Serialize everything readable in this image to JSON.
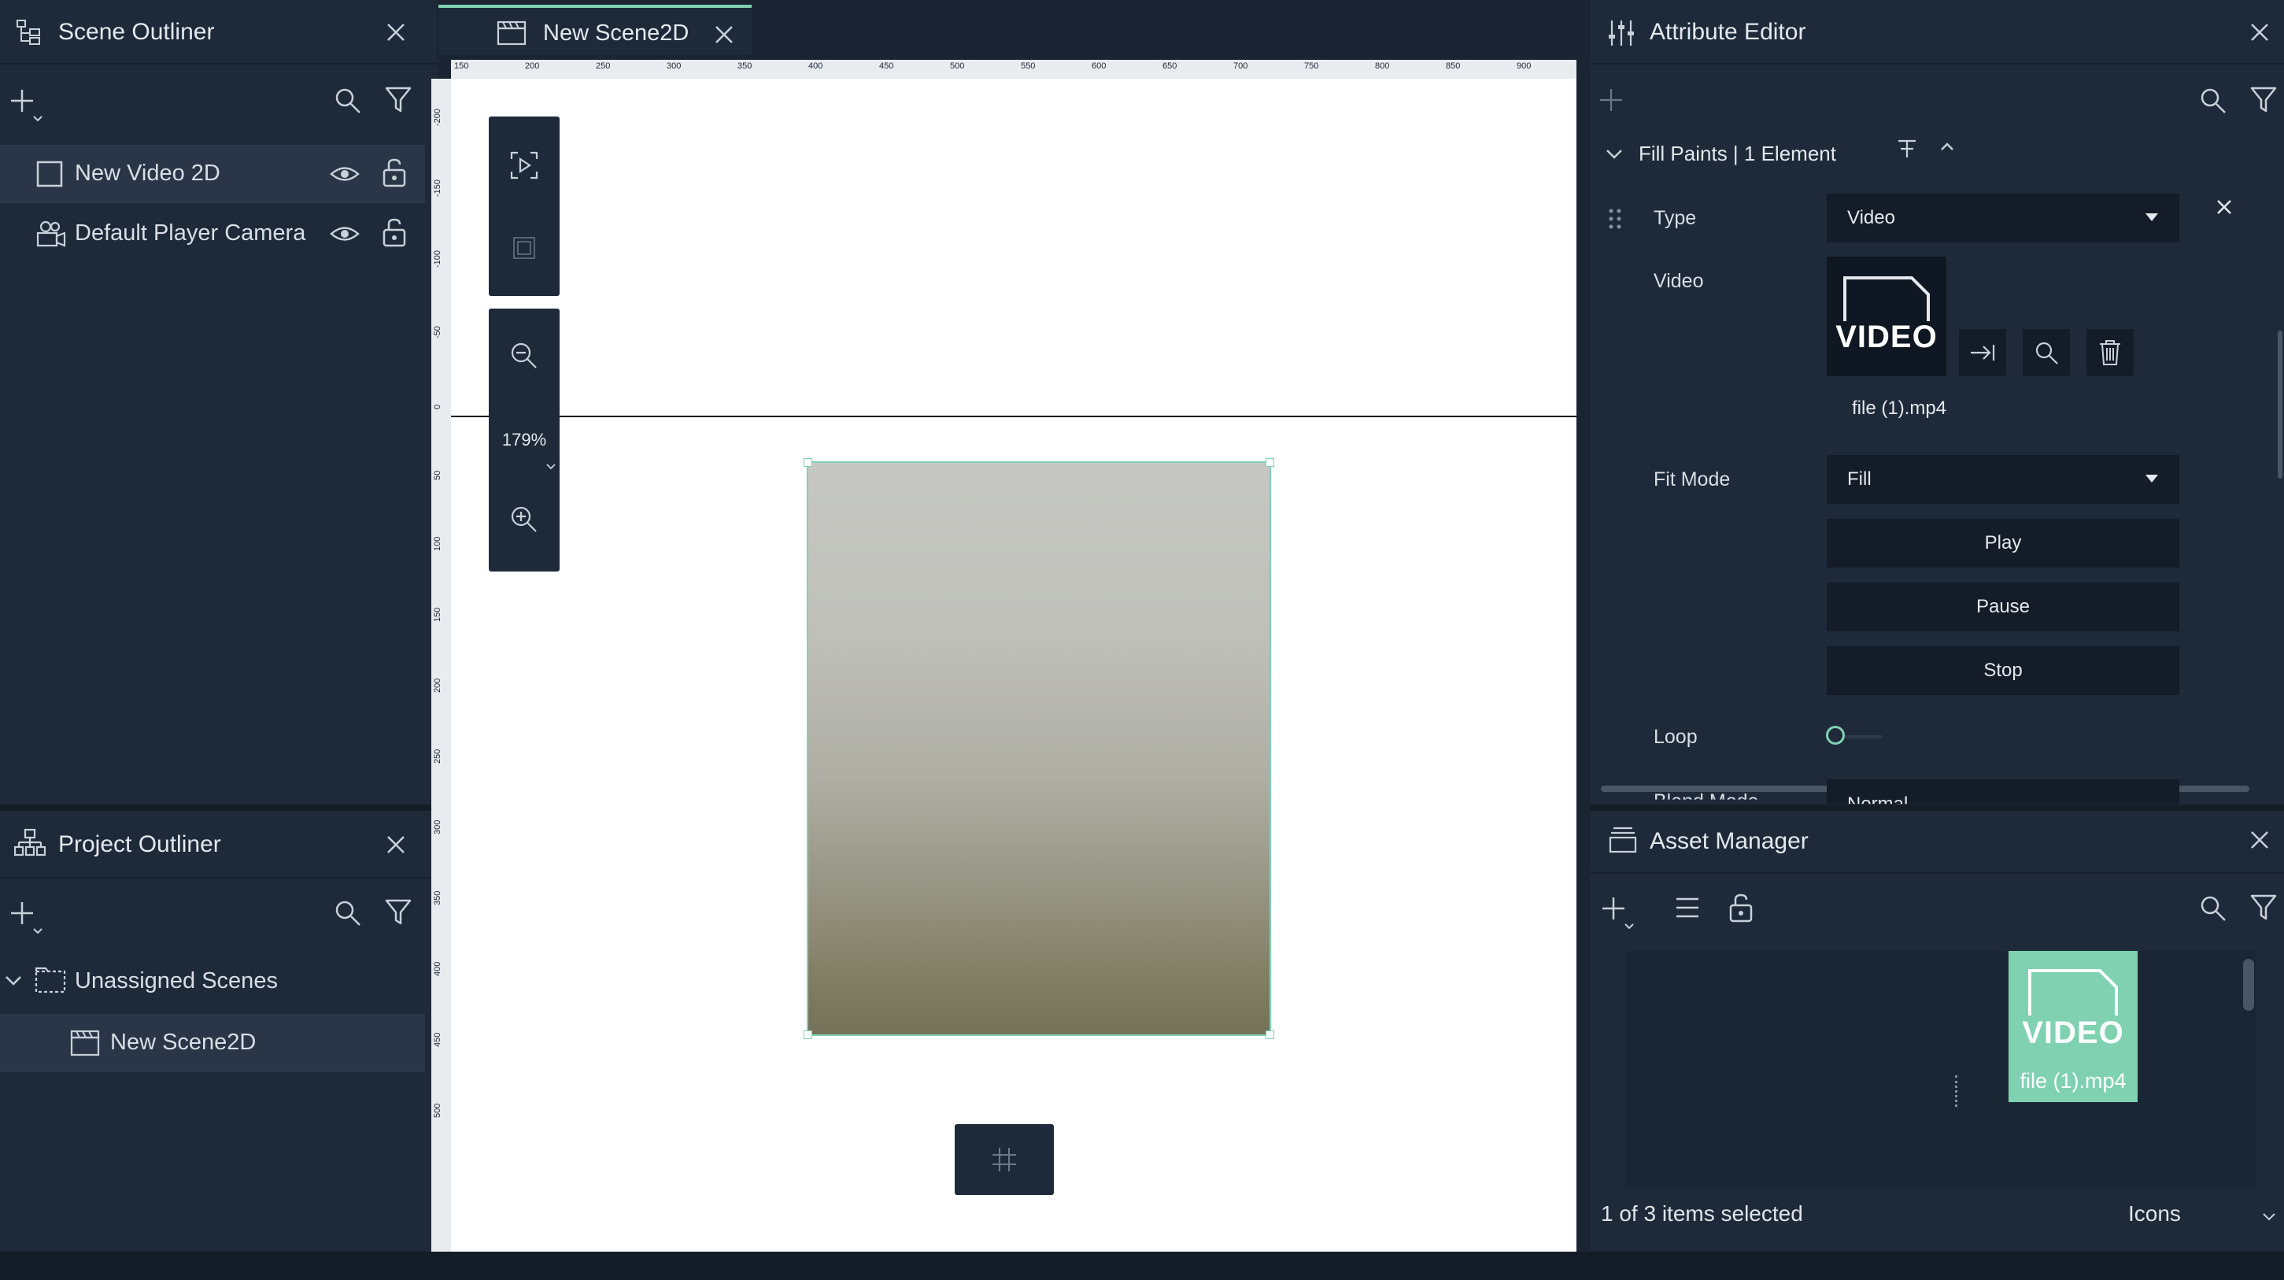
{
  "scene_outliner": {
    "title": "Scene Outliner",
    "items": [
      {
        "label": "New Video 2D"
      },
      {
        "label": "Default Player Camera"
      }
    ]
  },
  "project_outliner": {
    "title": "Project Outliner",
    "group": "Unassigned Scenes",
    "scene": "New Scene2D"
  },
  "viewport": {
    "tab_label": "New Scene2D",
    "zoom": "179%",
    "ruler_x": [
      "150",
      "200",
      "250",
      "300",
      "350",
      "400",
      "450",
      "500",
      "550",
      "600",
      "650",
      "700",
      "750",
      "800",
      "850",
      "900"
    ],
    "ruler_y": [
      "-200",
      "-150",
      "-100",
      "-50",
      "0",
      "50",
      "100",
      "150",
      "200",
      "250",
      "300",
      "350",
      "400",
      "450",
      "500"
    ]
  },
  "attribute_editor": {
    "title": "Attribute Editor",
    "section": "Fill Paints | 1 Element",
    "type_label": "Type",
    "type_value": "Video",
    "video_label": "Video",
    "video_thumb_text": "VIDEO",
    "file_name": "file (1).mp4",
    "fit_mode_label": "Fit Mode",
    "fit_mode_value": "Fill",
    "play": "Play",
    "pause": "Pause",
    "stop": "Stop",
    "loop_label": "Loop",
    "blend_mode_label": "Blend Mode",
    "blend_mode_value": "Normal"
  },
  "asset_manager": {
    "title": "Asset Manager",
    "asset_thumb_text": "VIDEO",
    "asset_name": "file (1).mp4",
    "status": "1 of 3 items selected",
    "view_mode": "Icons"
  },
  "colors": {
    "accent": "#7fd1b1",
    "panel": "#1e2a3a",
    "selected_row": "#2a3647",
    "button": "#131c28"
  }
}
